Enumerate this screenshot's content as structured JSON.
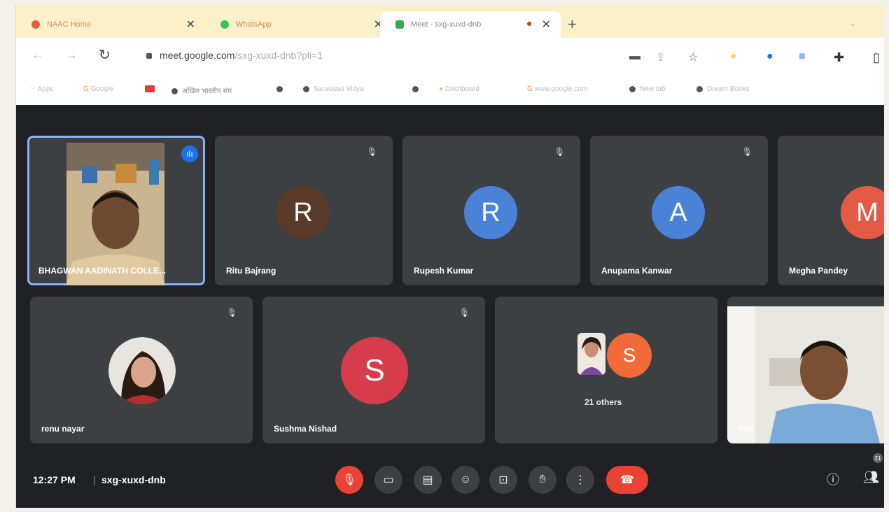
{
  "browser": {
    "tabs": [
      {
        "label": "NAAC Home",
        "active": false
      },
      {
        "label": "WhatsApp",
        "active": false
      },
      {
        "label": "Meet - sxg-xuxd-dnb",
        "active": true
      }
    ],
    "new_tab_icon": "+",
    "url_host": "meet.google.com",
    "url_path": "/sxg-xuxd-dnb?pli=1",
    "bookmarks": [
      "Apps",
      "Google",
      "",
      "अखिल भारतीय संघ",
      "",
      "Saraswati Vidya",
      "",
      "Dashboard",
      "www.google.com",
      "New tab",
      "Dream Books"
    ]
  },
  "meeting": {
    "code": "sxg-xuxd-dnb",
    "time": "12:27 PM",
    "participants": [
      {
        "name": "BHAGWAN AADINATH COLLE...",
        "type": "video",
        "speaking": true
      },
      {
        "name": "Ritu Bajrang",
        "initial": "R",
        "color": "#5c3a2a"
      },
      {
        "name": "Rupesh Kumar",
        "initial": "R",
        "color": "#4a82d8"
      },
      {
        "name": "Anupama Kanwar",
        "initial": "A",
        "color": "#4a82d8"
      },
      {
        "name": "Megha Pandey",
        "initial": "M",
        "color": "#e35b45"
      },
      {
        "name": "renu nayar",
        "type": "photo"
      },
      {
        "name": "Sushma Nishad",
        "initial": "S",
        "color": "#d73c4d"
      },
      {
        "name": "21 others",
        "initial": "S",
        "color": "#f26a3a"
      },
      {
        "name": "You",
        "type": "video"
      }
    ],
    "participant_count": "21"
  },
  "colors": {
    "meet_bg": "#202124",
    "tile_bg": "#3c4043",
    "active_outline": "#8ab4f8",
    "hangup": "#ea4335",
    "tabbar": "#fbf0c9"
  }
}
